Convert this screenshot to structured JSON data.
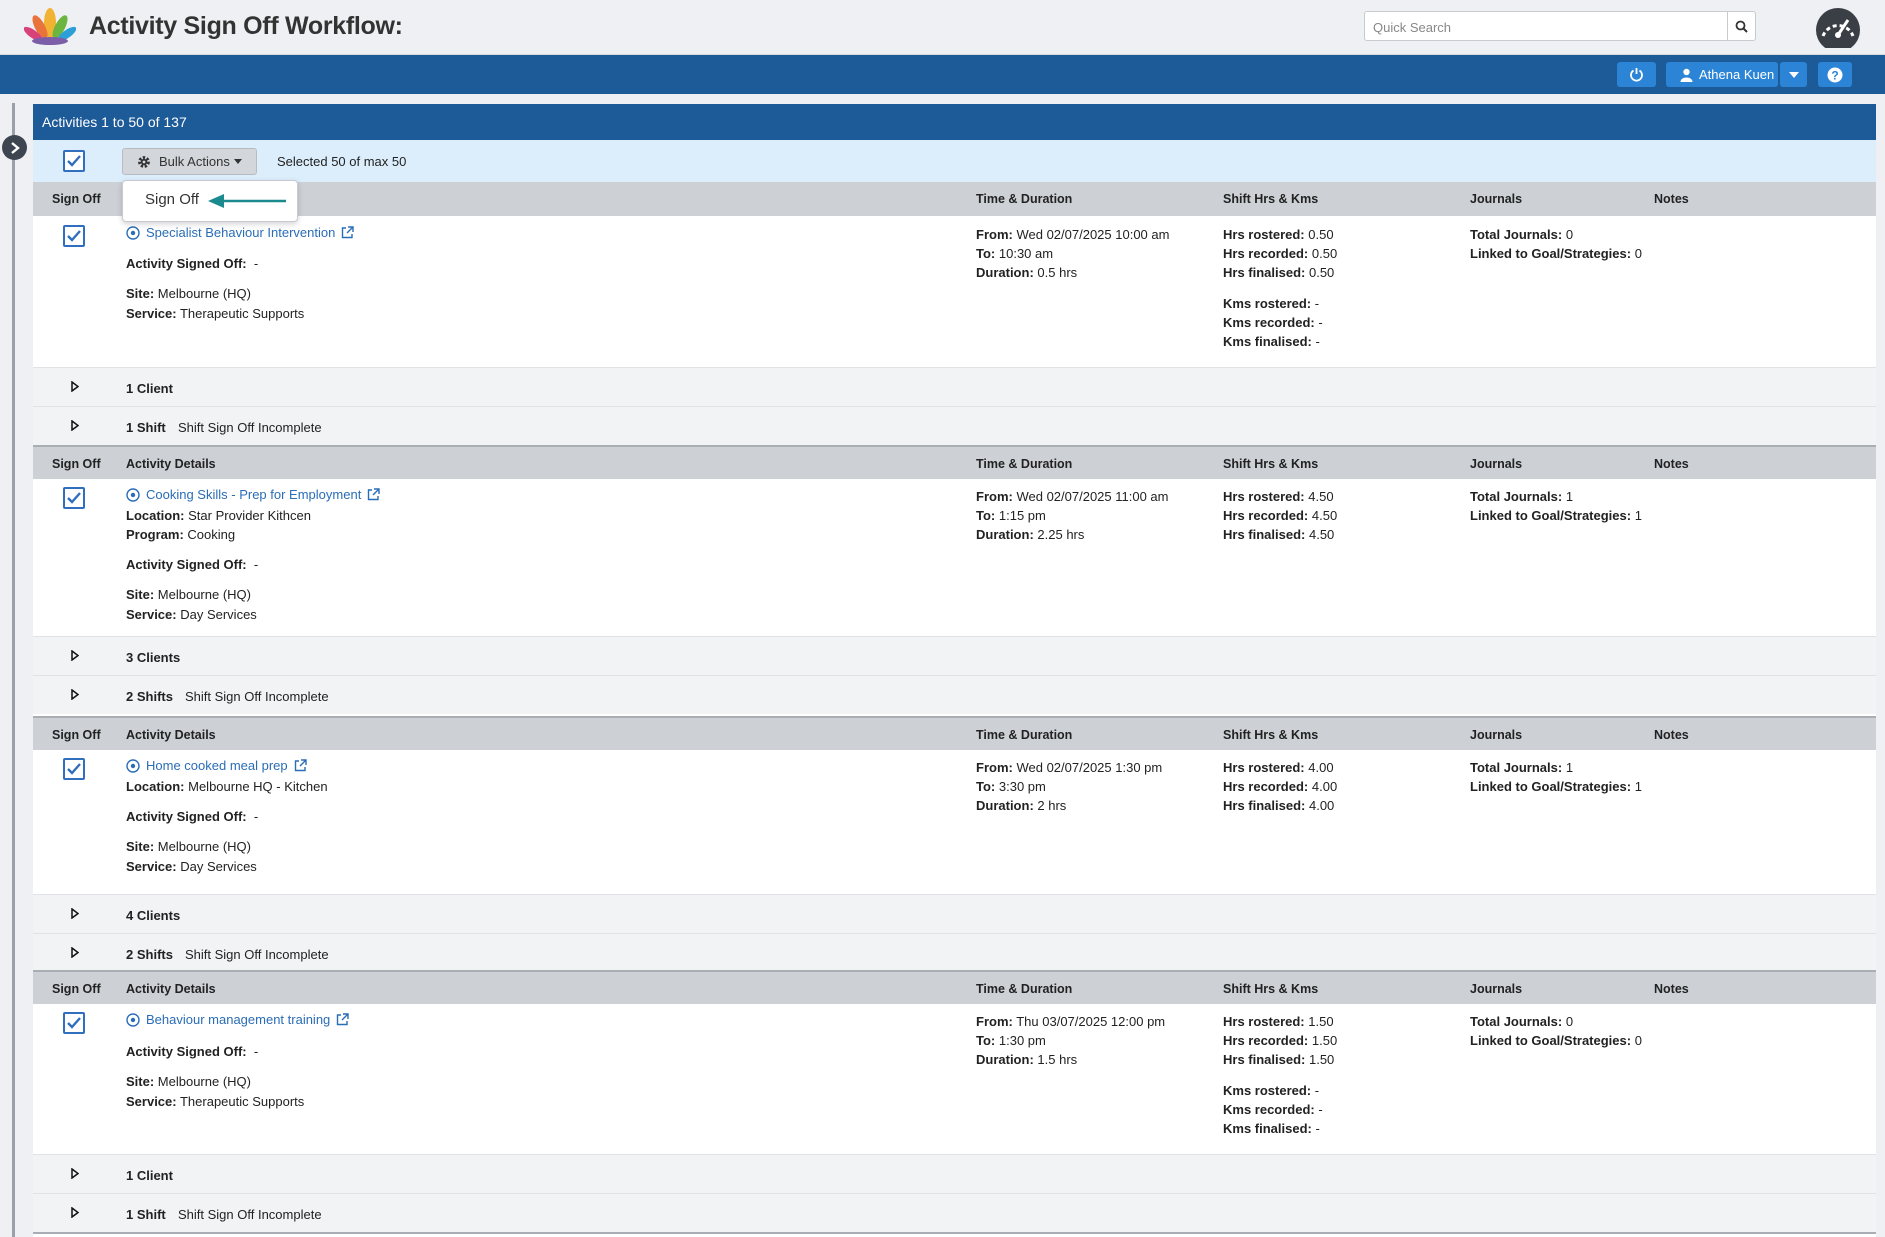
{
  "header": {
    "title": "Activity Sign Off Workflow:",
    "search_placeholder": "Quick Search",
    "user_name": "Athena Kuen"
  },
  "panel": {
    "title": "Activities 1 to 50 of 137",
    "bulk_actions_label": "Bulk Actions",
    "selected_text": "Selected 50 of max 50",
    "dropdown_items": [
      "Sign Off"
    ]
  },
  "columns": {
    "sign_off": "Sign Off",
    "activity_details": "Activity Details",
    "time_duration": "Time & Duration",
    "shift_hrs": "Shift Hrs & Kms",
    "journals": "Journals",
    "notes": "Notes"
  },
  "labels": {
    "location": "Location:",
    "program": "Program:",
    "activity_signed_off": "Activity Signed Off:",
    "site": "Site:",
    "service": "Service:",
    "from": "From:",
    "to": "To:",
    "duration": "Duration:",
    "hrs_rostered": "Hrs rostered:",
    "hrs_recorded": "Hrs recorded:",
    "hrs_finalised": "Hrs finalised:",
    "kms_rostered": "Kms rostered:",
    "kms_recorded": "Kms recorded:",
    "kms_finalised": "Kms finalised:",
    "total_journals": "Total Journals:",
    "linked_goals": "Linked to Goal/Strategies:"
  },
  "activities": [
    {
      "name": "Specialist Behaviour Intervention",
      "signed_off": "-",
      "site": "Melbourne (HQ)",
      "service": "Therapeutic Supports",
      "from": "Wed 02/07/2025 10:00 am",
      "to": "10:30 am",
      "duration": "0.5 hrs",
      "hrs_rostered": "0.50",
      "hrs_recorded": "0.50",
      "hrs_finalised": "0.50",
      "kms_rostered": "-",
      "kms_recorded": "-",
      "kms_finalised": "-",
      "total_journals": "0",
      "linked_goals": "0",
      "clients": "1 Client",
      "shifts": "1 Shift",
      "shift_status": "Shift Sign Off Incomplete",
      "checked": true
    },
    {
      "name": "Cooking Skills - Prep for Employment",
      "location": "Star Provider Kithcen",
      "program": "Cooking",
      "signed_off": "-",
      "site": "Melbourne (HQ)",
      "service": "Day Services",
      "from": "Wed 02/07/2025 11:00 am",
      "to": "1:15 pm",
      "duration": "2.25 hrs",
      "hrs_rostered": "4.50",
      "hrs_recorded": "4.50",
      "hrs_finalised": "4.50",
      "total_journals": "1",
      "linked_goals": "1",
      "clients": "3 Clients",
      "shifts": "2 Shifts",
      "shift_status": "Shift Sign Off Incomplete",
      "checked": true
    },
    {
      "name": "Home cooked meal prep",
      "location": "Melbourne HQ - Kitchen",
      "signed_off": "-",
      "site": "Melbourne (HQ)",
      "service": "Day Services",
      "from": "Wed 02/07/2025 1:30 pm",
      "to": "3:30 pm",
      "duration": "2 hrs",
      "hrs_rostered": "4.00",
      "hrs_recorded": "4.00",
      "hrs_finalised": "4.00",
      "total_journals": "1",
      "linked_goals": "1",
      "clients": "4 Clients",
      "shifts": "2 Shifts",
      "shift_status": "Shift Sign Off Incomplete",
      "checked": true
    },
    {
      "name": "Behaviour management training",
      "signed_off": "-",
      "site": "Melbourne (HQ)",
      "service": "Therapeutic Supports",
      "from": "Thu 03/07/2025 12:00 pm",
      "to": "1:30 pm",
      "duration": "1.5 hrs",
      "hrs_rostered": "1.50",
      "hrs_recorded": "1.50",
      "hrs_finalised": "1.50",
      "kms_rostered": "-",
      "kms_recorded": "-",
      "kms_finalised": "-",
      "total_journals": "0",
      "linked_goals": "0",
      "clients": "1 Client",
      "shifts": "1 Shift",
      "shift_status": "Shift Sign Off Incomplete",
      "checked": true
    }
  ],
  "colors": {
    "brand_blue": "#1d5a98",
    "button_blue": "#2b84d6",
    "link_blue": "#2a6db7",
    "arrow_teal": "#1b8a8f",
    "bulk_row_bg": "#dceefc"
  },
  "icons": {
    "search": "search-icon",
    "gauge": "dashboard-gauge-icon",
    "power": "power-icon",
    "user": "user-icon",
    "caret": "caret-down-icon",
    "help": "help-icon",
    "gear": "gear-icon",
    "external_link": "external-link-icon",
    "target": "target-icon",
    "expand": "expand-triangle-icon"
  }
}
